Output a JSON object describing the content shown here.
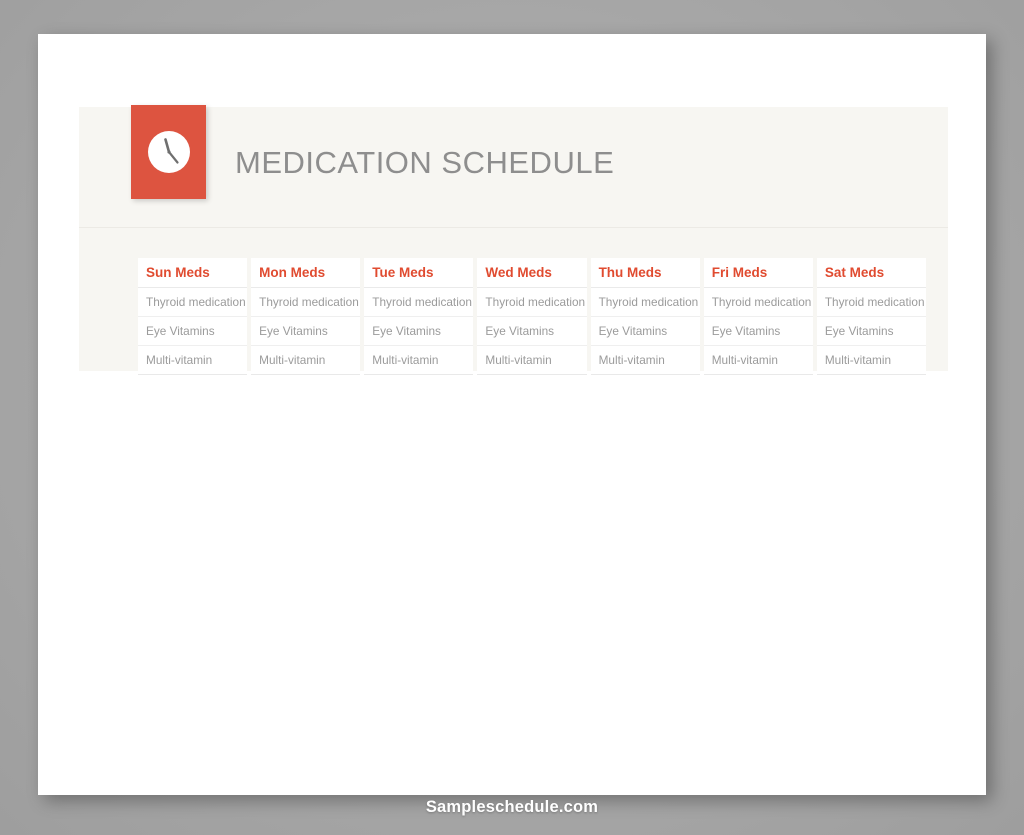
{
  "document": {
    "title": "MEDICATION SCHEDULE",
    "icon": "clock-icon",
    "accent_color": "#dd5440",
    "header_text_color": "#e04b30",
    "title_color": "#8e8e8e",
    "body_text_color": "#9b9b9b",
    "panel_background": "#f7f6f2",
    "page_background": "#ffffff",
    "canvas_background": "#a9a9a9"
  },
  "table": {
    "columns": [
      "Sun Meds",
      "Mon Meds",
      "Tue Meds",
      "Wed Meds",
      "Thu Meds",
      "Fri Meds",
      "Sat Meds"
    ],
    "rows": [
      [
        "Thyroid medication",
        "Thyroid medication",
        "Thyroid medication",
        "Thyroid medication",
        "Thyroid medication",
        "Thyroid medication",
        "Thyroid medication"
      ],
      [
        "Eye Vitamins",
        "Eye Vitamins",
        "Eye Vitamins",
        "Eye Vitamins",
        "Eye Vitamins",
        "Eye Vitamins",
        "Eye Vitamins"
      ],
      [
        "Multi-vitamin",
        "Multi-vitamin",
        "Multi-vitamin",
        "Multi-vitamin",
        "Multi-vitamin",
        "Multi-vitamin",
        "Multi-vitamin"
      ]
    ]
  },
  "footer": {
    "watermark": "Sampleschedule.com"
  }
}
